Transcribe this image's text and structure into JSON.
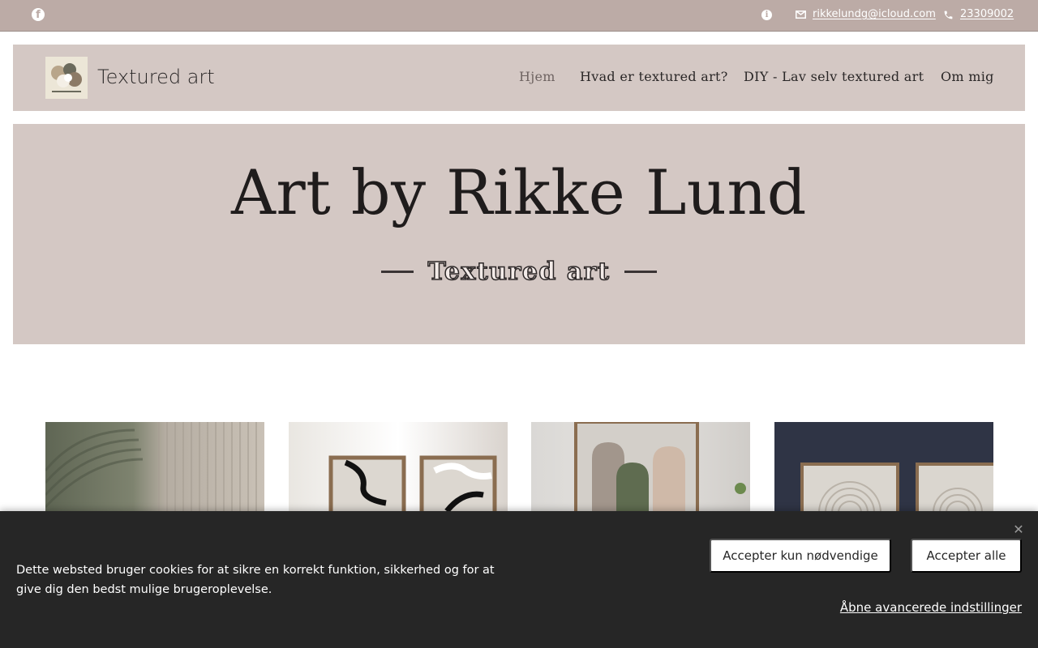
{
  "topbar": {
    "email": "rikkelundg@icloud.com",
    "phone": "23309002",
    "background_color": "#bcaba6"
  },
  "header": {
    "site_name": "Textured art",
    "nav": [
      {
        "label": "Hjem",
        "active": true
      },
      {
        "label": "Hvad er textured art?",
        "active": false
      },
      {
        "label": "DIY - Lav selv textured art",
        "active": false
      },
      {
        "label": "Om mig",
        "active": false
      }
    ],
    "background_color": "#d4c8c4"
  },
  "hero": {
    "title": "Art by Rikke Lund",
    "subtitle": "Textured art"
  },
  "cookie_banner": {
    "text": "Dette websted bruger cookies for at sikre en korrekt funktion, sikkerhed og for at give dig den bedst mulige brugeroplevelse.",
    "accept_necessary": "Accepter kun nødvendige",
    "accept_all": "Accepter alle",
    "advanced_settings": "Åbne avancerede indstillinger",
    "background_color": "#262626"
  },
  "icons": [
    "facebook-icon",
    "info-icon",
    "mail-icon",
    "phone-icon",
    "close-icon"
  ]
}
